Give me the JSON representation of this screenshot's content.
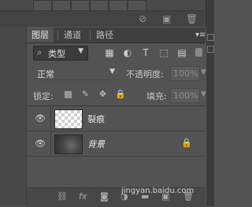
{
  "panel": {
    "tabs": [
      {
        "label": "图层",
        "active": true
      },
      {
        "label": "通道",
        "active": false
      },
      {
        "label": "路径",
        "active": false
      }
    ],
    "menu_icon": "panel-menu-icon"
  },
  "filter": {
    "kind_label": "类型",
    "search_icon": "search-icon",
    "icons": [
      "pixel-filter-icon",
      "adjustment-filter-icon",
      "type-filter-icon",
      "shape-filter-icon",
      "smart-object-filter-icon"
    ]
  },
  "blend": {
    "mode": "正常",
    "opacity_label": "不透明度:",
    "opacity_value": "100%"
  },
  "lock": {
    "label": "锁定:",
    "fill_label": "填充:",
    "fill_value": "100%"
  },
  "layers": [
    {
      "name": "裂痕",
      "visible": true,
      "thumbnail": "transparent",
      "locked": false,
      "italic": false
    },
    {
      "name": "背景",
      "visible": true,
      "thumbnail": "dark-texture",
      "locked": true,
      "italic": true
    }
  ],
  "footer": {
    "icons": [
      "link-icon",
      "fx-icon",
      "mask-icon",
      "adjustment-icon",
      "folder-icon",
      "new-layer-icon",
      "trash-icon"
    ],
    "watermark": "jingyan.baidu.com"
  },
  "colors": {
    "panel_bg": "#535353",
    "tab_bar": "#3f3f3f"
  }
}
